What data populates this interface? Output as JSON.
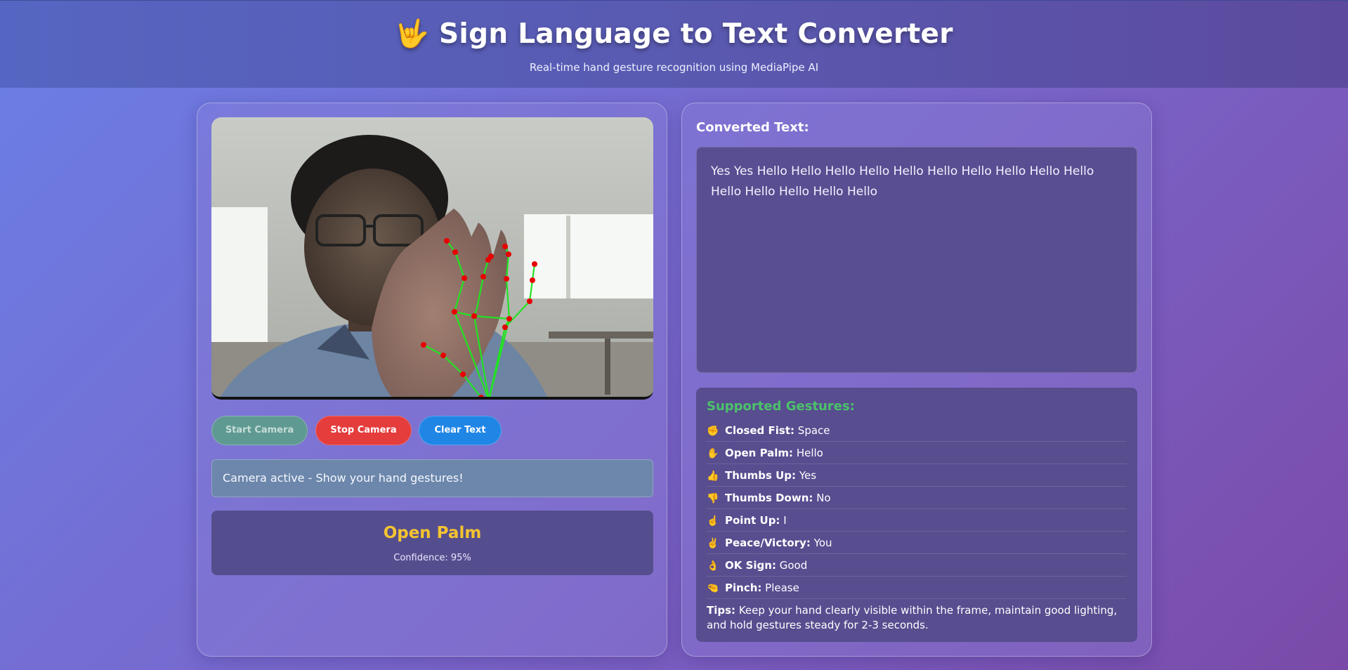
{
  "header": {
    "emoji": "🤟",
    "title": "Sign Language to Text Converter",
    "subtitle": "Real-time hand gesture recognition using MediaPipe AI"
  },
  "controls": {
    "start_label": "Start Camera",
    "stop_label": "Stop Camera",
    "clear_label": "Clear Text"
  },
  "status": {
    "text": "Camera active - Show your hand gestures!"
  },
  "detection": {
    "gesture": "Open Palm",
    "confidence": "Confidence: 95%"
  },
  "output": {
    "title": "Converted Text:",
    "text": "Yes Yes Hello Hello Hello Hello Hello Hello Hello Hello Hello Hello Hello Hello Hello Hello Hello"
  },
  "supported": {
    "title": "Supported Gestures:",
    "items": [
      {
        "icon": "✊",
        "icon_name": "closed-fist-icon",
        "name": "Closed Fist:",
        "meaning": "Space"
      },
      {
        "icon": "✋",
        "icon_name": "open-palm-icon",
        "name": "Open Palm:",
        "meaning": "Hello"
      },
      {
        "icon": "👍",
        "icon_name": "thumbs-up-icon",
        "name": "Thumbs Up:",
        "meaning": "Yes"
      },
      {
        "icon": "👎",
        "icon_name": "thumbs-down-icon",
        "name": "Thumbs Down:",
        "meaning": "No"
      },
      {
        "icon": "☝️",
        "icon_name": "point-up-icon",
        "name": "Point Up:",
        "meaning": "I"
      },
      {
        "icon": "✌️",
        "icon_name": "peace-icon",
        "name": "Peace/Victory:",
        "meaning": "You"
      },
      {
        "icon": "👌",
        "icon_name": "ok-sign-icon",
        "name": "OK Sign:",
        "meaning": "Good"
      },
      {
        "icon": "🤏",
        "icon_name": "pinch-icon",
        "name": "Pinch:",
        "meaning": "Please"
      }
    ],
    "tips_label": "Tips:",
    "tips_text": "Keep your hand clearly visible within the frame, maintain good lighting, and hold gestures steady for 2-3 seconds."
  },
  "colors": {
    "gesture_highlight": "#f4c430",
    "supported_title": "#4cc26a",
    "stop_button": "#e53c3c",
    "clear_button": "#1f86e6",
    "start_button": "#5f9a92",
    "landmark": "#e00000",
    "connection": "#22e322"
  }
}
